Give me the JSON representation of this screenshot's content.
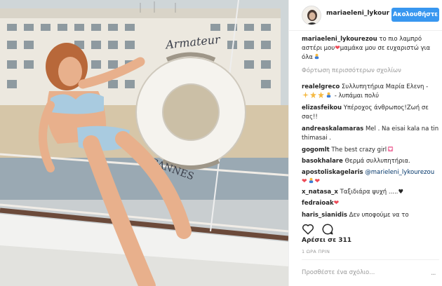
{
  "header": {
    "username": "mariaeleni_lykour",
    "follow_label": "Ακολουθήστε"
  },
  "photo": {
    "lifebuoy_top_text": "Armateur",
    "lifebuoy_bottom_text": "CANNES"
  },
  "caption": {
    "user": "mariaeleni_lykourezou",
    "text": "το πιο λαμπρό αστέρι μου",
    "text2": "μαμάκα μου σε ευχαριστώ για όλα"
  },
  "load_more": "Φόρτωση περισσότερων σχολίων",
  "comments": [
    {
      "user": "realelgreco",
      "text": "Συλλυπητήρια Μαρία Ελενη -",
      "text2": "- λυπάμαι πολύ"
    },
    {
      "user": "elizasfeikou",
      "text": "Υπέροχος άνθρωπος!Ζωή σε σας!!"
    },
    {
      "user": "andreaskalamaras",
      "text": "Mel . Na eisai kala na tin thimasai ."
    },
    {
      "user": "gogomlt",
      "text": "The best crazy girl"
    },
    {
      "user": "basokhalare",
      "text": "Θερμά συλλυπητήρια."
    },
    {
      "user": "apostoliskagelaris",
      "mention": "@marieleni_lykourezou"
    },
    {
      "user": "x_natasa_x",
      "text": "Ταξιδιάρα ψυχή ....."
    },
    {
      "user": "fedraioak",
      "text": ""
    },
    {
      "user": "haris_sianidis",
      "text": "Δεν υποφούμε να το"
    }
  ],
  "likes": "Αρέσει σε 311",
  "time": "1 ΩΡΑ ΠΡΙΝ",
  "comment_input": {
    "placeholder": "Προσθέστε ένα σχόλιο..."
  },
  "more_options": "...",
  "colors": {
    "accent": "#3897f0",
    "heart": "#ed4956",
    "muted": "#999999",
    "mention": "#003569"
  },
  "icons": [
    "heart-outline-icon",
    "comment-bubble-icon",
    "red-heart-icon",
    "sparkle-icon",
    "bowing-person-icon",
    "gift-heart-icon",
    "black-heart-icon"
  ]
}
